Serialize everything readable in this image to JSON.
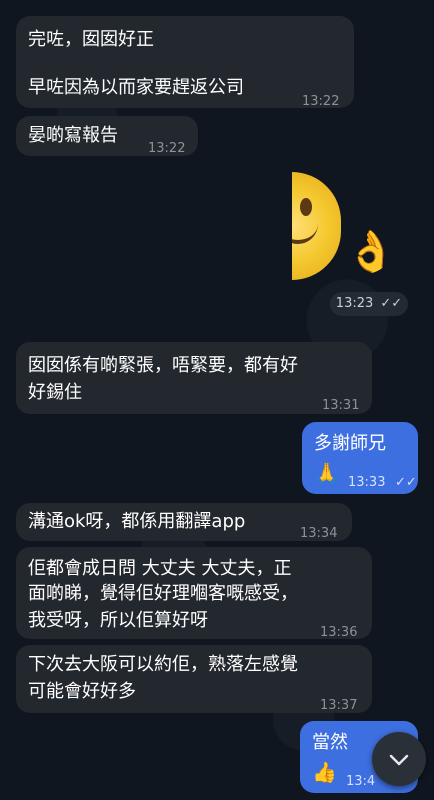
{
  "messages": [
    {
      "text": "完咗，囡囡好正",
      "text2": "早咗因為以而家要趕返公司",
      "time": "13:22"
    },
    {
      "text": "晏啲寫報告",
      "time": "13:22"
    },
    {
      "sticker_emoji": "👌",
      "time": "13:23"
    },
    {
      "text": "囡囡係有啲緊張，唔緊要，都有好",
      "text2": "好錫住",
      "time": "13:31"
    },
    {
      "text": "多謝師兄",
      "emoji": "🙏",
      "time": "13:33"
    },
    {
      "text": "溝通ok呀，都係用翻譯app",
      "time": "13:34"
    },
    {
      "text": "佢都會成日問 大丈夫 大丈夫，正",
      "text2": "面啲睇，覺得佢好理嗰客嘅感受，",
      "text3": "我受呀，所以佢算好呀",
      "time": "13:36"
    },
    {
      "text": "下次去大阪可以約佢，熟落左感覺",
      "text2": "可能會好好多",
      "time": "13:37"
    },
    {
      "text": "當然",
      "emoji": "👍",
      "time": "13:4"
    }
  ],
  "checks_glyph": "✓✓",
  "colors": {
    "incoming": "#23272e",
    "outgoing": "#3e6fe0",
    "background": "#0e1621"
  }
}
